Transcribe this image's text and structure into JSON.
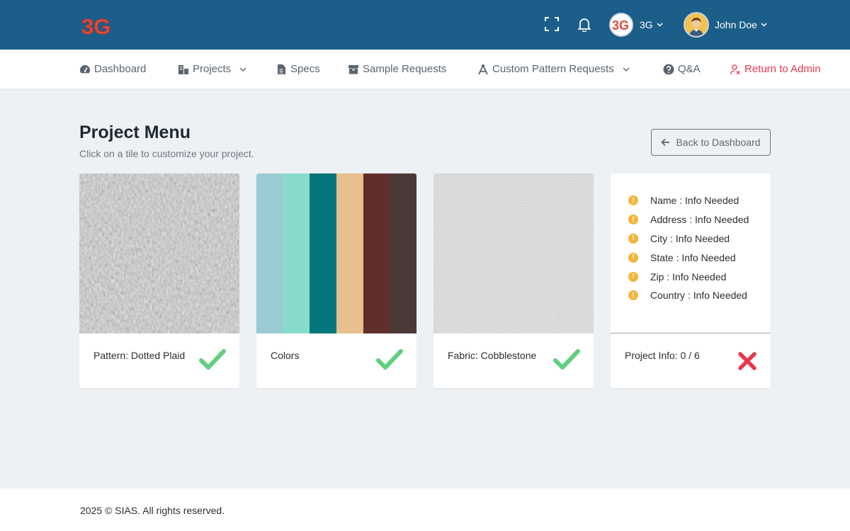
{
  "header": {
    "logo_text": "3G",
    "org_name": "3G",
    "user_name": "John Doe",
    "icons": [
      "fullscreen-icon",
      "bell-icon"
    ]
  },
  "nav": {
    "items": [
      {
        "label": "Dashboard",
        "icon": "dashboard-icon"
      },
      {
        "label": "Projects",
        "icon": "projects-icon",
        "dropdown": true
      },
      {
        "label": "Specs",
        "icon": "file-icon"
      },
      {
        "label": "Sample Requests",
        "icon": "archive-icon"
      },
      {
        "label": "Custom Pattern Requests",
        "icon": "compass-icon",
        "dropdown": true
      },
      {
        "label": "Q&A",
        "icon": "question-icon"
      },
      {
        "label": "Return to Admin",
        "icon": "user-x-icon"
      }
    ]
  },
  "main": {
    "title": "Project Menu",
    "subtitle": "Click on a tile to customize your project.",
    "back_label": "Back to Dashboard",
    "tiles": [
      {
        "label": "Pattern: Dotted Plaid",
        "status": "complete"
      },
      {
        "label": "Colors",
        "status": "complete",
        "swatches": [
          "#99cbd3",
          "#88dbcb",
          "#02767c",
          "#e8c08d",
          "#612e2b",
          "#4b3937"
        ]
      },
      {
        "label": "Fabric: Cobblestone",
        "status": "complete"
      },
      {
        "label": "Project Info: 0 / 6",
        "status": "incomplete",
        "info": [
          {
            "text": "Name : Info Needed"
          },
          {
            "text": "Address : Info Needed"
          },
          {
            "text": "City : Info Needed"
          },
          {
            "text": "State : Info Needed"
          },
          {
            "text": "Zip : Info Needed"
          },
          {
            "text": "Country : Info Needed"
          }
        ]
      }
    ]
  },
  "footer": {
    "text": "2025 © SIAS. All rights reserved."
  },
  "colors": {
    "header": "#1b5e89",
    "check": "#5fcf7e",
    "cross": "#e8384f",
    "warning": "#f5b53d",
    "admin": "#e8384f"
  }
}
